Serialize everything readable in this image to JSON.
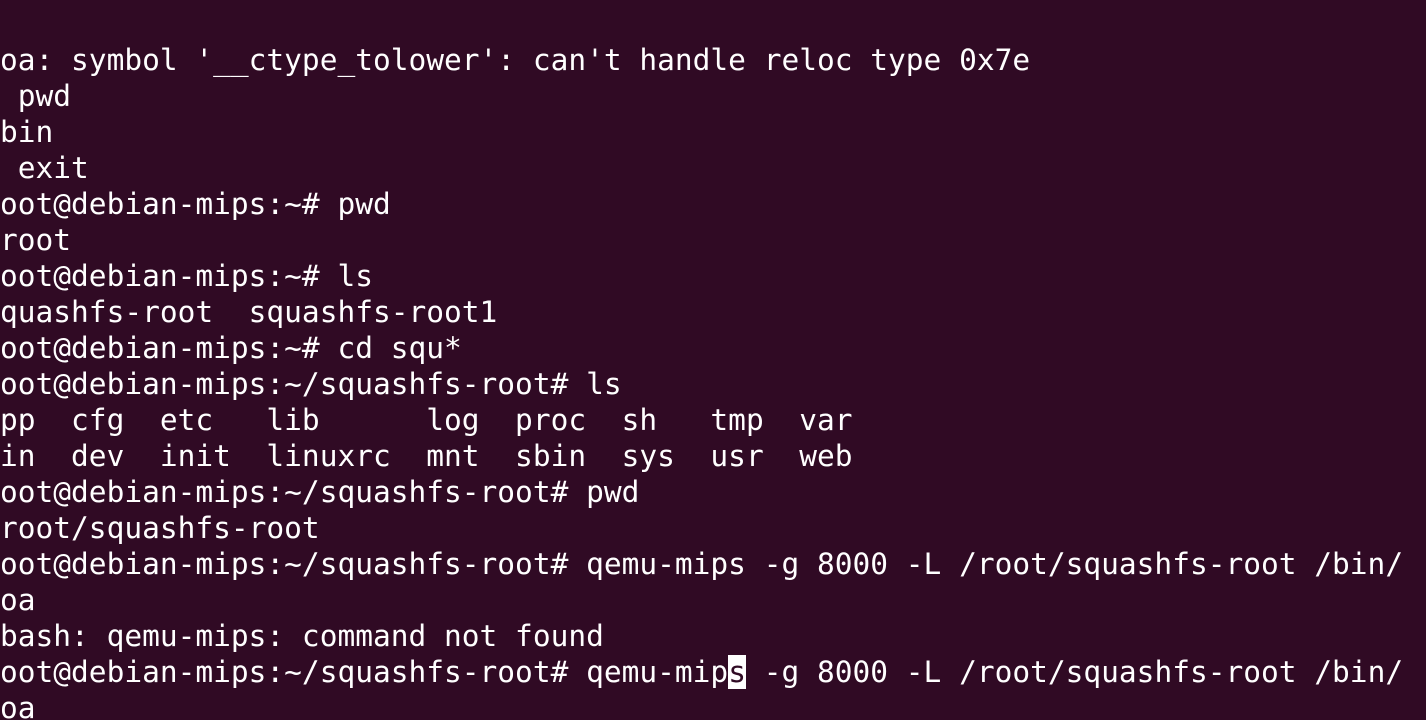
{
  "terminal": {
    "colors": {
      "background": "#300a24",
      "foreground": "#ffffff"
    },
    "lines": [
      "oa: symbol '__ctype_tolower': can't handle reloc type 0x7e",
      " pwd",
      "bin",
      " exit",
      "oot@debian-mips:~# pwd",
      "root",
      "oot@debian-mips:~# ls",
      "quashfs-root  squashfs-root1",
      "oot@debian-mips:~# cd squ*",
      "oot@debian-mips:~/squashfs-root# ls",
      "pp  cfg  etc   lib      log  proc  sh   tmp  var",
      "in  dev  init  linuxrc  mnt  sbin  sys  usr  web",
      "oot@debian-mips:~/squashfs-root# pwd",
      "root/squashfs-root",
      "oot@debian-mips:~/squashfs-root# qemu-mips -g 8000 -L /root/squashfs-root /bin/",
      "oa",
      "bash: qemu-mips: command not found"
    ],
    "current_line": {
      "before_cursor": "oot@debian-mips:~/squashfs-root# qemu-mip",
      "cursor_char": "s",
      "after_cursor": " -g 8000 -L /root/squashfs-root /bin/"
    },
    "last_line": "oa"
  }
}
